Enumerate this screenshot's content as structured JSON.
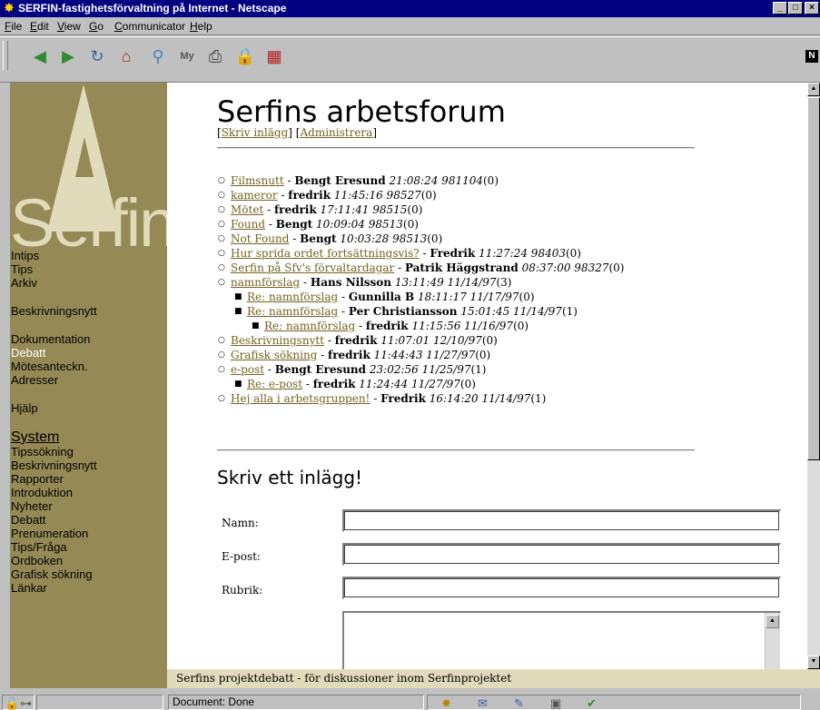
{
  "window": {
    "title": "SERFIN-fastighetsförvaltning på Internet - Netscape",
    "app_icon": "netscape-star-icon",
    "controls": [
      "_",
      "□",
      "×"
    ]
  },
  "menu": [
    {
      "label": "File",
      "key": "F"
    },
    {
      "label": "Edit",
      "key": "E"
    },
    {
      "label": "View",
      "key": "V"
    },
    {
      "label": "Go",
      "key": "G"
    },
    {
      "label": "Communicator",
      "key": "C"
    },
    {
      "label": "Help",
      "key": "H"
    }
  ],
  "toolbar": {
    "buttons": [
      "back-icon",
      "forward-icon",
      "reload-icon",
      "home-icon",
      "search-icon",
      "guide-icon",
      "print-icon",
      "security-icon",
      "stop-icon"
    ]
  },
  "sidebar": {
    "logo_letter": "A",
    "logo_text": "Serfin",
    "nav": [
      {
        "label": "Intips"
      },
      {
        "label": "Tips"
      },
      {
        "label": "Arkiv"
      },
      {
        "gap": true
      },
      {
        "label": "Beskrivningsnytt"
      },
      {
        "gap": true
      },
      {
        "label": "Dokumentation"
      },
      {
        "label": "Debatt",
        "active": true
      },
      {
        "label": "Mötesanteckn."
      },
      {
        "label": "Adresser"
      },
      {
        "gap": true
      },
      {
        "label": "Hjälp"
      },
      {
        "gap": true
      },
      {
        "label": "System",
        "heading": true
      },
      {
        "label": "Tipssökning"
      },
      {
        "label": "Beskrivningsnytt"
      },
      {
        "label": "Rapporter"
      },
      {
        "label": "Introduktion"
      },
      {
        "label": "Nyheter"
      },
      {
        "label": "Debatt"
      },
      {
        "label": "Prenumeration"
      },
      {
        "label": "Tips/Fråga"
      },
      {
        "label": "Ordboken"
      },
      {
        "label": "Grafisk sökning"
      },
      {
        "label": "Länkar"
      }
    ]
  },
  "main": {
    "title": "Serfins arbetsforum",
    "links": {
      "write": "Skriv inlägg",
      "admin": "Administrera",
      "open": "[",
      "mid": "] [",
      "close": "]"
    },
    "threads": [
      {
        "level": 1,
        "subject": "Filmsnutt",
        "author": "Bengt Eresund",
        "date": "21:08:24 981104",
        "count": "(0)"
      },
      {
        "level": 1,
        "subject": "kameror",
        "author": "fredrik",
        "date": "11:45:16 98527",
        "count": "(0)"
      },
      {
        "level": 1,
        "subject": "Mötet",
        "author": "fredrik",
        "date": "17:11:41 98515",
        "count": "(0)"
      },
      {
        "level": 1,
        "subject": "Found",
        "author": "Bengt",
        "date": "10:09:04 98513",
        "count": "(0)"
      },
      {
        "level": 1,
        "subject": "Not Found",
        "author": "Bengt",
        "date": "10:03:28 98513",
        "count": "(0)"
      },
      {
        "level": 1,
        "subject": "Hur sprida ordet fortsättningsvis?",
        "author": "Fredrik",
        "date": "11:27:24 98403",
        "count": "(0)"
      },
      {
        "level": 1,
        "subject": "Serfin på Sfv's förvaltardagar",
        "author": "Patrik Häggstrand",
        "date": "08:37:00 98327",
        "count": "(0)"
      },
      {
        "level": 1,
        "subject": "namnförslag",
        "author": "Hans Nilsson",
        "date": "13:11:49 11/14/97",
        "count": "(3)"
      },
      {
        "level": 2,
        "subject": "Re: namnförslag",
        "author": "Gunnilla B",
        "date": "18:11:17 11/17/97",
        "count": "(0)"
      },
      {
        "level": 2,
        "subject": "Re: namnförslag",
        "author": "Per Christiansson",
        "date": "15:01:45 11/14/97",
        "count": "(1)"
      },
      {
        "level": 3,
        "subject": "Re: namnförslag",
        "author": "fredrik",
        "date": "11:15:56 11/16/97",
        "count": "(0)"
      },
      {
        "level": 1,
        "subject": "Beskrivningsnytt",
        "author": "fredrik",
        "date": "11:07:01 12/10/97",
        "count": "(0)"
      },
      {
        "level": 1,
        "subject": "Grafisk sökning",
        "author": "fredrik",
        "date": "11:44:43 11/27/97",
        "count": "(0)"
      },
      {
        "level": 1,
        "subject": "e-post",
        "author": "Bengt Eresund",
        "date": "23:02:56 11/25/97",
        "count": "(1)"
      },
      {
        "level": 2,
        "subject": "Re: e-post",
        "author": "fredrik",
        "date": "11:24:44 11/27/97",
        "count": "(0)"
      },
      {
        "level": 1,
        "subject": "Hej alla i arbetsgruppen!",
        "author": "Fredrik",
        "date": "16:14:20 11/14/97",
        "count": "(1)"
      }
    ],
    "separator": " - ",
    "form": {
      "heading": "Skriv ett inlägg!",
      "name_label": "Namn:",
      "name_value": "",
      "email_label": "E-post:",
      "email_value": "",
      "subject_label": "Rubrik:",
      "subject_value": ""
    }
  },
  "footer": {
    "text": "Serfins projektdebatt - för diskussioner inom Serfinprojektet"
  },
  "status": {
    "text": "Document: Done",
    "left_icons": [
      "padlock-icon",
      "connection-icon"
    ],
    "right_icons": [
      "netscape-icon",
      "mail-icon",
      "discussion-icon",
      "composer-icon",
      "bookmark-icon"
    ]
  }
}
